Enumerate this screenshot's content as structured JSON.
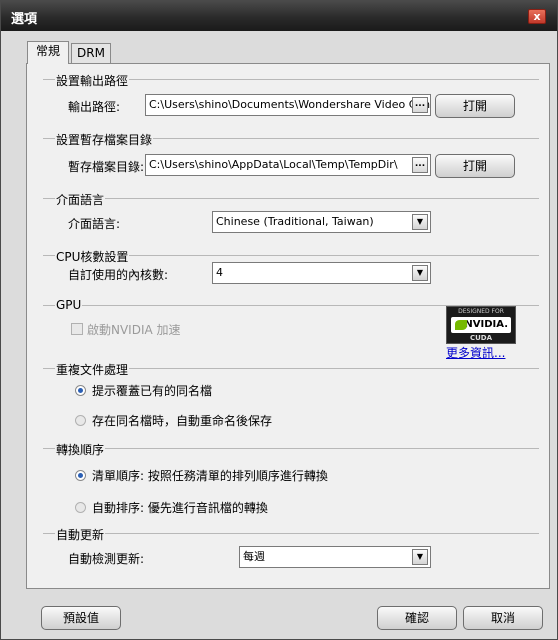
{
  "window": {
    "title": "選項",
    "close": "x"
  },
  "tabs": [
    "常規",
    "DRM"
  ],
  "output": {
    "group": "設置輸出路徑",
    "label": "輸出路徑:",
    "value": "C:\\Users\\shino\\Documents\\Wondershare Video Conve",
    "browse": "...",
    "open": "打開"
  },
  "temp": {
    "group": "設置暫存檔案目錄",
    "label": "暫存檔案目錄:",
    "value": "C:\\Users\\shino\\AppData\\Local\\Temp\\TempDir\\",
    "browse": "...",
    "open": "打開"
  },
  "language": {
    "group": "介面語言",
    "label": "介面語言:",
    "value": "Chinese (Traditional, Taiwan)"
  },
  "cpu": {
    "group": "CPU核數設置",
    "label": "自訂使用的內核數:",
    "value": "4"
  },
  "gpu": {
    "group": "GPU",
    "checkbox": "啟動NVIDIA 加速",
    "checked": false,
    "badge": {
      "top": "DESIGNED FOR",
      "brand": "NVIDIA.",
      "bottom": "CUDA"
    },
    "more": "更多資訊..."
  },
  "duplicate": {
    "group": "重複文件處理",
    "opt1": "提示覆蓋已有的同名檔",
    "opt2": "存在同名檔時，自動重命名後保存"
  },
  "order": {
    "group": "轉換順序",
    "opt1": "清單順序: 按照任務清單的排列順序進行轉換",
    "opt2": "自動排序: 優先進行音訊檔的轉換"
  },
  "update": {
    "group": "自動更新",
    "label": "自動檢測更新:",
    "value": "每週"
  },
  "footer": {
    "defaults": "預設值",
    "ok": "確認",
    "cancel": "取消"
  },
  "colors": {
    "titlebar": "#2a2a2a",
    "close": "#c0392b",
    "link": "#0000cc",
    "radio": "#2b5fb4",
    "nvidia": "#76b900"
  }
}
